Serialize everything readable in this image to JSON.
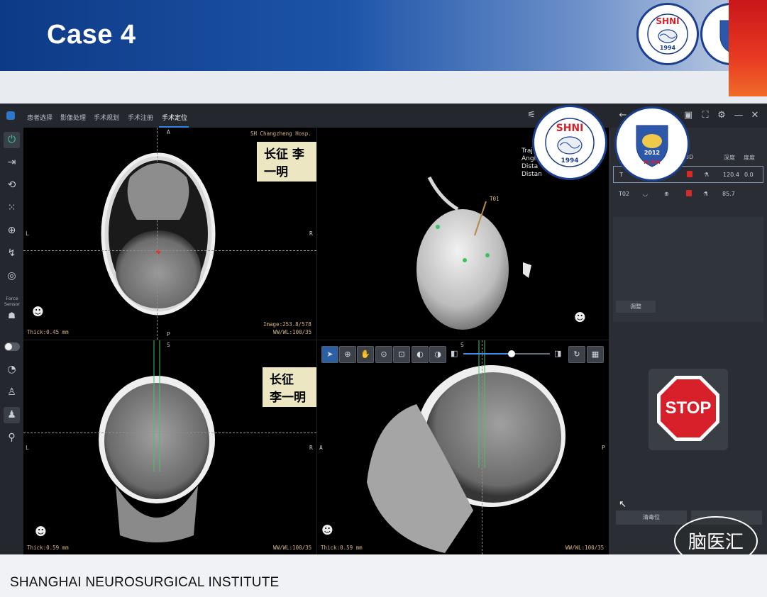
{
  "slide": {
    "title": "Case 4",
    "footer": "SHANGHAI NEUROSURGICAL INSTITUTE",
    "logo_shni": {
      "name": "SHNI",
      "year": "1994",
      "ring_text": "SHANGHAI NEUROSURGICAL INSTITUTE"
    },
    "logo_plani": {
      "name": "PLANI",
      "year": "2012"
    },
    "watermark": "脑医汇"
  },
  "app": {
    "nav_tabs": [
      "患者选择",
      "影像处理",
      "手术规划",
      "手术注册",
      "手术定位"
    ],
    "active_tab": "手术定位",
    "sidebar": {
      "force_sensor_label": "Force Sensor"
    },
    "viewports": {
      "axial": {
        "hospital": "SH Changzheng Hosp.",
        "name_tag": "长征 李一明",
        "thick": "Thick:0.45 mm",
        "image": "Image:253.8/578",
        "wwwl": "WW/WL:100/35",
        "orient": {
          "top": "A",
          "bottom": "P",
          "left": "L",
          "right": "R"
        }
      },
      "render3d": {
        "label": "T01",
        "traj_lines": [
          "Traj",
          "Angl",
          "Dista",
          "Distan"
        ]
      },
      "coronal": {
        "name_tag": "长征 李一明",
        "thick": "Thick:0.59 mm",
        "wwwl": "WW/WL:100/35",
        "orient": {
          "top": "S",
          "left": "L",
          "right": "R"
        }
      },
      "sagittal": {
        "thick": "Thick:0.59 mm",
        "wwwl": "WW/WL:100/35",
        "orient": {
          "top": "S",
          "left": "A",
          "right": "P"
        }
      }
    },
    "toolbar": {
      "slider_value": 0.56
    },
    "panel": {
      "headers": [
        "3D",
        "深度",
        "度度"
      ],
      "rows": [
        {
          "id": "T",
          "depth": "120.4",
          "angle": "0.0",
          "selected": true
        },
        {
          "id": "T02",
          "depth": "85.7",
          "angle": "",
          "selected": false
        }
      ],
      "adjust_button": "调整",
      "stop_label": "STOP",
      "bottom_button": "清毒位"
    }
  },
  "colors": {
    "accent": "#2f86e0",
    "stop_red": "#d8202a",
    "overlay_text": "#d8b483",
    "header_blue": "#0d3a86"
  }
}
